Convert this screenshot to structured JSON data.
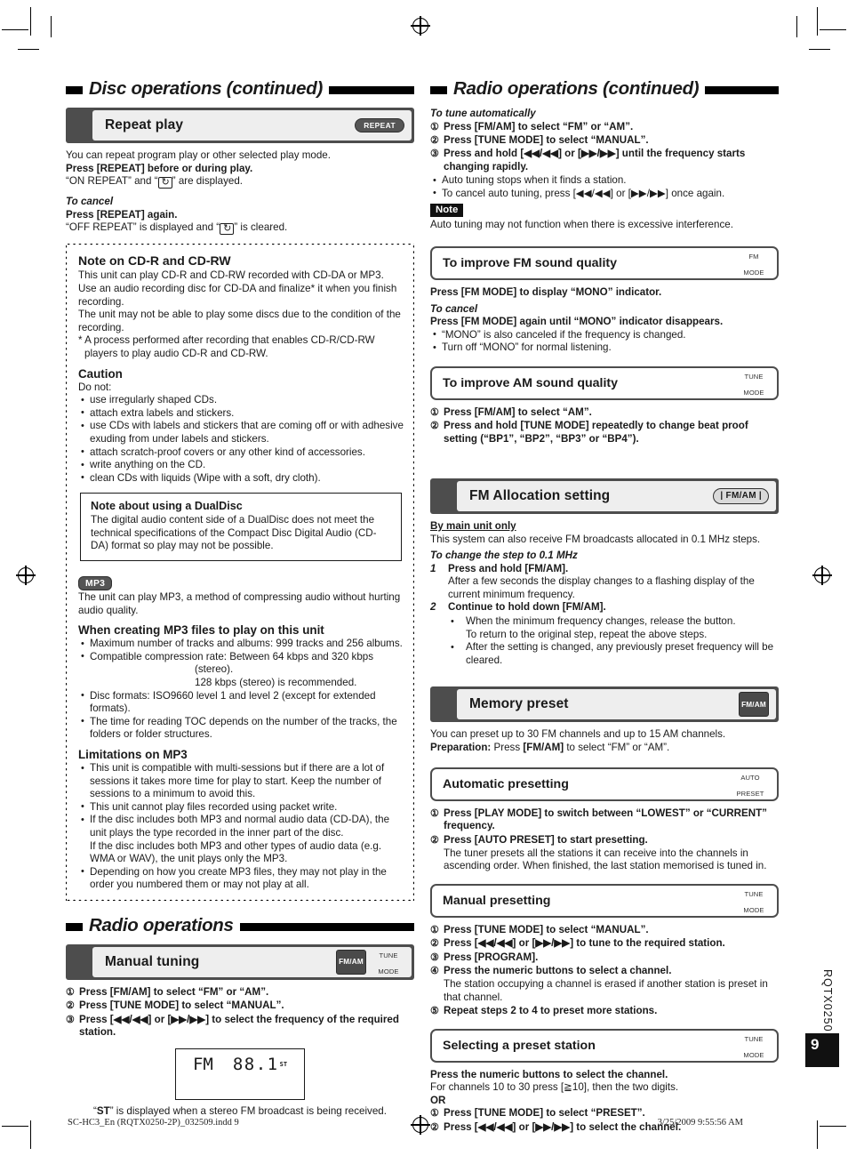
{
  "meta": {
    "page_number": "9",
    "doc_code": "RQTX0250",
    "footer_left": "SC-HC3_En (RQTX0250-2P)_032509.indd   9",
    "footer_right": "3/25/2009   9:55:56 AM"
  },
  "left_column": {
    "section_title": "Disc operations (continued)",
    "repeat_play": {
      "heading": "Repeat play",
      "key_badge": "REPEAT",
      "intro": "You can repeat program play or other selected play mode.",
      "instruction": "Press [REPEAT] before or during play.",
      "display_line_pre": "“ON REPEAT” and “",
      "display_line_post": "” are displayed.",
      "cancel_label": "To cancel",
      "cancel_instruction": "Press [REPEAT] again.",
      "cancel_display_pre": "“OFF REPEAT” is displayed and “",
      "cancel_display_post": "” is cleared."
    },
    "note_cdr": {
      "heading": "Note on CD-R and CD-RW",
      "para1": "This unit can play CD-R and CD-RW recorded with CD-DA or MP3.",
      "para2": "Use an audio recording disc for CD-DA and finalize* it when you finish recording.",
      "para3": "The unit may not be able to play some discs due to the condition of the recording.",
      "footnote": "* A process performed after recording that enables CD-R/CD-RW players to play audio CD-R and CD-RW."
    },
    "caution": {
      "heading": "Caution",
      "lead": "Do not:",
      "items": [
        "use irregularly shaped CDs.",
        "attach extra labels and stickers.",
        "use CDs with labels and stickers that are coming off or with adhesive exuding from under labels and stickers.",
        "attach scratch-proof covers or any other kind of accessories.",
        "write anything on the CD.",
        "clean CDs with liquids (Wipe with a soft, dry cloth)."
      ]
    },
    "dualdisc": {
      "heading": "Note about using a DualDisc",
      "body": "The digital audio content side of a DualDisc does not meet the technical specifications of the Compact Disc Digital Audio (CD-DA) format so play may not be possible."
    },
    "mp3": {
      "badge": "MP3",
      "intro": "The unit can play MP3, a method of compressing audio without hurting audio quality.",
      "creating_heading": "When creating MP3 files to play on this unit",
      "creating_items": [
        "Maximum number of tracks and albums: 999 tracks and 256 albums.",
        "Compatible compression rate: Between 64 kbps and 320 kbps",
        "Disc formats: ISO9660 level 1 and level 2 (except for extended formats).",
        "The time for reading TOC depends on the number of the tracks, the folders or folder structures."
      ],
      "creating_sub_a": "(stereo).",
      "creating_sub_b": "128 kbps (stereo) is recommended.",
      "limitations_heading": "Limitations on MP3",
      "limitations_items": [
        "This unit is compatible with multi-sessions but if there are a lot of sessions it takes more time for play to start. Keep the number of sessions to a minimum to avoid this.",
        "This unit cannot play files recorded using packet write.",
        "If the disc includes both MP3 and normal audio data (CD-DA), the unit plays the type recorded in the inner part of the disc.",
        "Depending on how you create MP3 files, they may not play in the order you numbered them or may not play at all."
      ],
      "limitations_item3_extra": "If the disc includes both MP3 and other types of audio data (e.g. WMA or WAV), the unit plays only the MP3."
    },
    "radio_section_title": "Radio operations",
    "manual_tuning": {
      "heading": "Manual tuning",
      "key_fmam": "FM/AM",
      "key_tune_line1": "TUNE",
      "key_tune_line2": "MODE",
      "steps": [
        "Press [FM/AM] to select “FM” or “AM”.",
        "Press [TUNE MODE] to select “MANUAL”.",
        "Press [◀◀/◀◀] or [▶▶/▶▶] to select the frequency of the required station."
      ],
      "display": {
        "band": "FM",
        "frequency": "88.1",
        "indicator": "ST"
      },
      "caption_pre": "“",
      "caption_bold": "ST",
      "caption_post": "” is displayed when a stereo FM broadcast is being received."
    }
  },
  "right_column": {
    "section_title": "Radio operations (continued)",
    "auto_tune": {
      "label": "To tune automatically",
      "steps": [
        "Press [FM/AM] to select “FM” or “AM”.",
        "Press [TUNE MODE] to select “MANUAL”.",
        "Press and hold [◀◀/◀◀] or [▶▶/▶▶] until the frequency starts changing rapidly."
      ],
      "bullets": [
        "Auto tuning stops when it finds a station.",
        "To cancel auto tuning, press [◀◀/◀◀] or [▶▶/▶▶] once again."
      ],
      "note_badge": "Note",
      "note_text": "Auto tuning may not function when there is excessive interference."
    },
    "fm_quality": {
      "heading": "To improve FM sound quality",
      "key_line1": "FM",
      "key_line2": "MODE",
      "instruction": "Press [FM MODE] to display “MONO” indicator.",
      "cancel_label": "To cancel",
      "cancel_instruction": "Press [FM MODE] again until “MONO” indicator disappears.",
      "bullets": [
        "“MONO” is also canceled if the frequency is changed.",
        "Turn off “MONO” for normal listening."
      ]
    },
    "am_quality": {
      "heading": "To improve AM sound quality",
      "key_line1": "TUNE",
      "key_line2": "MODE",
      "steps": [
        "Press [FM/AM] to select “AM”.",
        "Press and hold [TUNE MODE] repeatedly to change beat proof setting (“BP1”, “BP2”, “BP3” or “BP4”)."
      ]
    },
    "fm_allocation": {
      "heading": "FM Allocation setting",
      "key_badge": "| FM/AM |",
      "main_unit_only": "By main unit only",
      "intro": "This system can also receive FM broadcasts allocated in 0.1 MHz steps.",
      "change_label": "To change the step to 0.1 MHz",
      "step1_num": "1",
      "step1_bold": "Press and hold [FM/AM].",
      "step1_body": "After a few seconds the display changes to a flashing display of the current minimum frequency.",
      "step2_num": "2",
      "step2_bold": "Continue to hold down [FM/AM].",
      "step2_bullets": [
        "When the minimum frequency changes, release the button.",
        "After the setting is changed, any previously preset frequency will be cleared."
      ],
      "step2_bullet1_extra": "To return to the original step, repeat the above steps."
    },
    "memory_preset": {
      "heading": "Memory preset",
      "key_badge": "FM/AM",
      "intro": "You can preset up to 30 FM channels and up to 15 AM channels.",
      "preparation_bold": "Preparation:",
      "preparation_rest_a": " Press ",
      "preparation_rest_b": "[FM/AM]",
      "preparation_rest_c": " to select “FM” or “AM”."
    },
    "auto_preset": {
      "heading": "Automatic presetting",
      "key_line1": "AUTO",
      "key_line2": "PRESET",
      "steps": [
        "Press [PLAY MODE] to switch between “LOWEST” or “CURRENT” frequency.",
        "Press [AUTO PRESET] to start presetting."
      ],
      "step2_body": "The tuner presets all the stations it can receive into the channels in ascending order. When finished, the last station memorised is tuned in."
    },
    "manual_preset": {
      "heading": "Manual presetting",
      "key_line1": "TUNE",
      "key_line2": "MODE",
      "steps": [
        "Press [TUNE MODE] to select “MANUAL”.",
        "Press [◀◀/◀◀] or [▶▶/▶▶] to tune to the required station.",
        "Press [PROGRAM].",
        "Press the numeric buttons to select a channel.",
        "Repeat steps 2 to 4 to preset more stations."
      ],
      "step4_body": "The station occupying a channel is erased if another station is preset in that channel."
    },
    "select_preset": {
      "heading": "Selecting a preset station",
      "key_line1": "TUNE",
      "key_line2": "MODE",
      "instruction": "Press the numeric buttons to select the channel.",
      "detail": "For channels 10 to 30 press [≧10], then the two digits.",
      "or_label": "OR",
      "steps": [
        "Press [TUNE MODE] to select “PRESET”.",
        "Press [◀◀/◀◀] or [▶▶/▶▶] to select the channel."
      ]
    }
  }
}
